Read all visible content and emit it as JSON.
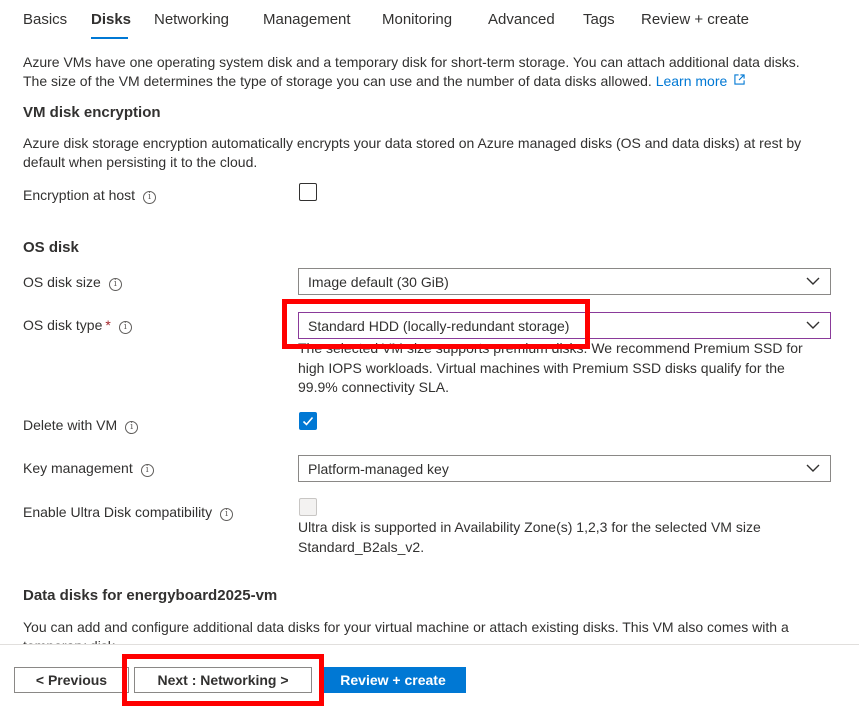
{
  "tabs": [
    {
      "label": "Basics"
    },
    {
      "label": "Disks"
    },
    {
      "label": "Networking"
    },
    {
      "label": "Management"
    },
    {
      "label": "Monitoring"
    },
    {
      "label": "Advanced"
    },
    {
      "label": "Tags"
    },
    {
      "label": "Review + create"
    }
  ],
  "active_tab": "Disks",
  "intro": {
    "text": "Azure VMs have one operating system disk and a temporary disk for short-term storage. You can attach additional data disks. The size of the VM determines the type of storage you can use and the number of data disks allowed.",
    "learn_more": "Learn more"
  },
  "encryption": {
    "heading": "VM disk encryption",
    "description": "Azure disk storage encryption automatically encrypts your data stored on Azure managed disks (OS and data disks) at rest by default when persisting it to the cloud.",
    "host_label": "Encryption at host",
    "host_checked": false
  },
  "os_disk": {
    "heading": "OS disk",
    "size_label": "OS disk size",
    "size_value": "Image default (30 GiB)",
    "type_label": "OS disk type",
    "required_mark": "*",
    "type_value": "Standard HDD (locally-redundant storage)",
    "type_helper": "The selected VM size supports premium disks. We recommend Premium SSD for high IOPS workloads. Virtual machines with Premium SSD disks qualify for the 99.9% connectivity SLA.",
    "delete_label": "Delete with VM",
    "delete_checked": true,
    "key_label": "Key management",
    "key_value": "Platform-managed key",
    "ultra_label": "Enable Ultra Disk compatibility",
    "ultra_checked": false,
    "ultra_helper": "Ultra disk is supported in Availability Zone(s) 1,2,3 for the selected VM size Standard_B2als_v2."
  },
  "data_disks": {
    "heading": "Data disks for energyboard2025-vm",
    "description": "You can add and configure additional data disks for your virtual machine or attach existing disks. This VM also comes with a temporary disk."
  },
  "footer": {
    "previous": "< Previous",
    "next": "Next : Networking >",
    "review": "Review + create"
  },
  "colors": {
    "accent": "#0078d4",
    "highlight": "#ff0000",
    "required": "#a4262c"
  },
  "icons": {
    "info": "info-icon",
    "chevron": "chevron-down-icon",
    "external": "external-link-icon",
    "check": "checkmark-icon"
  }
}
